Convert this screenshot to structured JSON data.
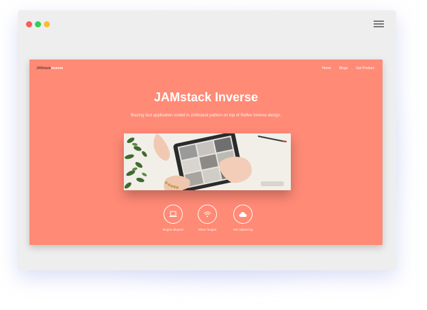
{
  "window": {
    "controls": [
      "close",
      "minimize",
      "maximize"
    ],
    "menu_icon": "hamburger-menu-icon"
  },
  "site": {
    "brand": {
      "prefix": "JAMstack",
      "suffix": "Inverse"
    },
    "nav": [
      "Home",
      "Blogs",
      "Get Product"
    ],
    "hero": {
      "title": "JAMstack Inverse",
      "subtitle": "Blazing fast application coded in JAMstack pattern on top of Reflex Inverse design."
    },
    "features": [
      {
        "icon": "laptop-icon",
        "label": "Magna aliquam"
      },
      {
        "icon": "wifi-icon",
        "label": "Etiam feugiat"
      },
      {
        "icon": "cloud-icon",
        "label": "Nisl adipiscing"
      }
    ]
  },
  "colors": {
    "page_bg": "#ff8a76",
    "browser_bg": "#eeeeee",
    "dot_close": "#fc5c57",
    "dot_min": "#2fcf59",
    "dot_max": "#fdbc2f"
  }
}
